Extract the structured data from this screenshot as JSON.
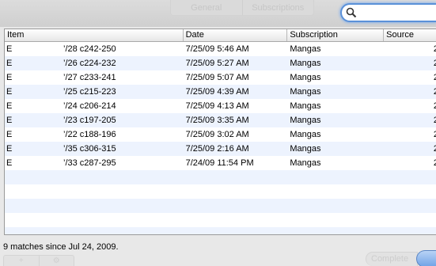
{
  "toolbar": {
    "tabs": [
      "General",
      "Subscriptions"
    ]
  },
  "search": {
    "value": ""
  },
  "table": {
    "columns": [
      "Item",
      "Date",
      "Subscription",
      "Source"
    ],
    "rows": [
      {
        "lead": "E",
        "item": "’/28 c242-250",
        "date": "7/25/09 5:46 AM",
        "subscription": "Mangas",
        "source": "2"
      },
      {
        "lead": "E",
        "item": "’/26 c224-232",
        "date": "7/25/09 5:27 AM",
        "subscription": "Mangas",
        "source": "2"
      },
      {
        "lead": "E",
        "item": "’/27 c233-241",
        "date": "7/25/09 5:07 AM",
        "subscription": "Mangas",
        "source": "2"
      },
      {
        "lead": "E",
        "item": "’/25 c215-223",
        "date": "7/25/09 4:39 AM",
        "subscription": "Mangas",
        "source": "2"
      },
      {
        "lead": "E",
        "item": "’/24 c206-214",
        "date": "7/25/09 4:13 AM",
        "subscription": "Mangas",
        "source": "2"
      },
      {
        "lead": "E",
        "item": "’/23 c197-205",
        "date": "7/25/09 3:35 AM",
        "subscription": "Mangas",
        "source": "2"
      },
      {
        "lead": "E",
        "item": "’/22 c188-196",
        "date": "7/25/09 3:02 AM",
        "subscription": "Mangas",
        "source": "2"
      },
      {
        "lead": "E",
        "item": "’/35 c306-315",
        "date": "7/25/09 2:16 AM",
        "subscription": "Mangas",
        "source": "2"
      },
      {
        "lead": "E",
        "item": "’/33 c287-295",
        "date": "7/24/09 11:54 PM",
        "subscription": "Mangas",
        "source": "2"
      }
    ],
    "empty_rows": 6
  },
  "status": {
    "text": "9 matches since Jul 24, 2009."
  },
  "bottom": {
    "add_label": "+",
    "gear_label": "⚙",
    "faint_button_label": "Complete"
  },
  "colors": {
    "accent": "#5b91d8",
    "stripe": "#edf3fe"
  }
}
